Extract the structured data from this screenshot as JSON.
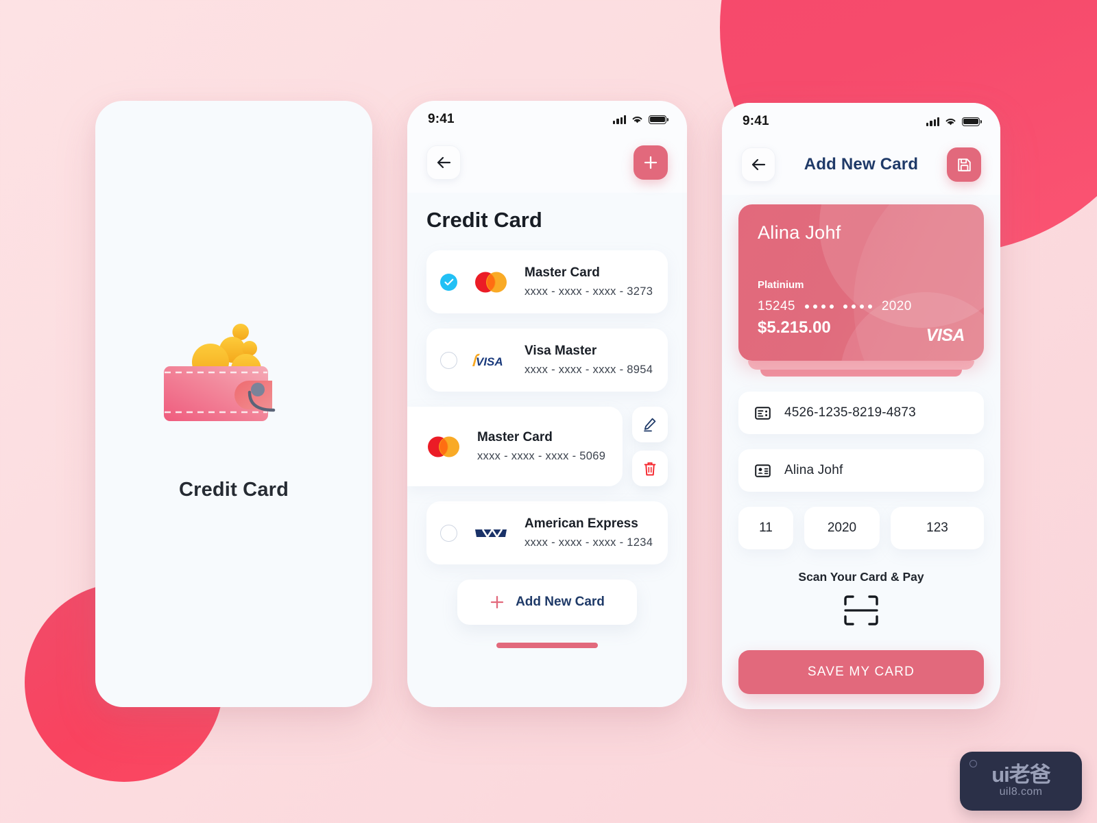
{
  "colors": {
    "accent": "#e2697c",
    "accent_deep": "#f7496a",
    "navy": "#1f3a68",
    "check_blue": "#22c0f5",
    "delete_red": "#f5252c",
    "bg_page": "#fde2e4",
    "screen_bg": "#f7fafd"
  },
  "status_bar": {
    "time": "9:41",
    "icons": [
      "signal-icon",
      "wifi-icon",
      "battery-icon"
    ]
  },
  "screen_onboarding": {
    "name": "onboarding-screen",
    "illustration": "wallet-with-coins-illustration",
    "title": "Credit Card"
  },
  "screen_card_list": {
    "name": "credit-card-list-screen",
    "nav": {
      "back_icon": "arrow-left-icon",
      "add_icon": "plus-icon"
    },
    "heading": "Credit Card",
    "cards": [
      {
        "selected": true,
        "brand": "mastercard",
        "title": "Master Card",
        "number": "xxxx - xxxx - xxxx - 3273",
        "swiped": false
      },
      {
        "selected": false,
        "brand": "visa",
        "title": "Visa Master",
        "number": "xxxx - xxxx - xxxx - 8954",
        "swiped": false
      },
      {
        "selected": false,
        "brand": "mastercard",
        "title": "Master Card",
        "number": "xxxx - xxxx - xxxx - 5069",
        "swiped": true,
        "actions": [
          "edit-icon",
          "delete-icon"
        ]
      },
      {
        "selected": false,
        "brand": "amex",
        "title": "American Express",
        "number": "xxxx - xxxx - xxxx - 1234",
        "swiped": false
      }
    ],
    "add_button": {
      "icon": "plus-icon",
      "label": "Add New Card"
    }
  },
  "screen_add_card": {
    "name": "add-new-card-screen",
    "nav": {
      "back_icon": "arrow-left-icon",
      "title": "Add New Card",
      "save_icon": "save-disk-icon"
    },
    "card_preview": {
      "holder": "Alina Johf",
      "tier": "Platinium",
      "number_prefix": "15245",
      "number_suffix": "2020",
      "masked_groups": 2,
      "masked_dots_per_group": 4,
      "amount": "$5.215.00",
      "brand": "VISA"
    },
    "fields": [
      {
        "icon": "card-number-icon",
        "value": "4526-1235-8219-4873",
        "name": "card-number-field"
      },
      {
        "icon": "card-holder-icon",
        "value": "Alina Johf",
        "name": "card-holder-field"
      }
    ],
    "expiry": {
      "month": "11",
      "year": "2020",
      "cvv": "123"
    },
    "scan": {
      "label": "Scan Your Card & Pay",
      "icon": "scan-frame-icon"
    },
    "save_button": "SAVE MY CARD"
  },
  "watermark": {
    "main": "ui老爸",
    "sub": "uil8.com"
  }
}
